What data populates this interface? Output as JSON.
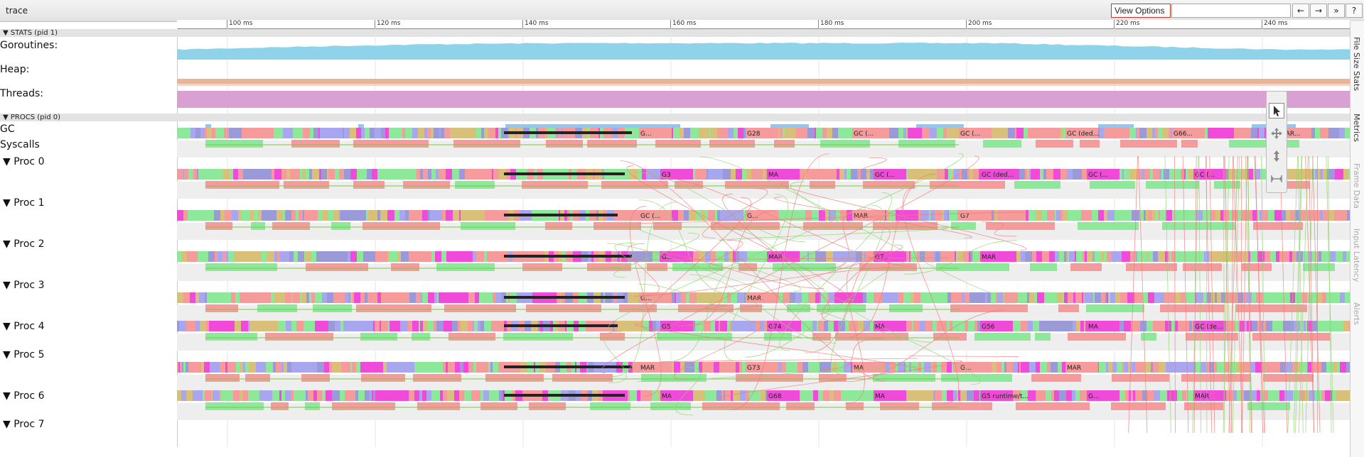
{
  "window": {
    "title": "trace"
  },
  "toolbar": {
    "view_options_label": "View Options",
    "search_placeholder": "",
    "prev_label": "←",
    "next_label": "→",
    "more_label": "»",
    "help_label": "?"
  },
  "ruler": {
    "ticks": [
      "100 ms",
      "120 ms",
      "140 ms",
      "160 ms",
      "180 ms",
      "200 ms",
      "220 ms",
      "240 ms"
    ]
  },
  "stats": {
    "header": "▼ STATS (pid 1)",
    "tracks": [
      {
        "label": "Goroutines:",
        "color": "#8fd3ea"
      },
      {
        "label": "Heap:",
        "color": "#e8b49a"
      },
      {
        "label": "Threads:",
        "color": "#d9a0d4"
      }
    ]
  },
  "procs": {
    "header": "▼ PROCS (pid 0)",
    "gc_label": "GC",
    "syscalls_label": "Syscalls",
    "gc_slice_label": "GC",
    "items": [
      {
        "label": "▼  Proc 0",
        "slices": [
          "G...",
          "G28",
          "GC (...",
          "GC (...",
          "GC (ded...",
          "G66...",
          "MAR...",
          "GC (..."
        ]
      },
      {
        "label": "▼  Proc 1",
        "slices": [
          "G3",
          "MA",
          "GC (...",
          "GC (ded...",
          "GC (...",
          "GC (..."
        ]
      },
      {
        "label": "▼  Proc 2",
        "slices": [
          "GC (...",
          "G...",
          "MAR",
          "G7"
        ]
      },
      {
        "label": "▼  Proc 3",
        "slices": [
          "G...",
          "MAR",
          "G7..",
          "MAR"
        ]
      },
      {
        "label": "▼  Proc 4",
        "slices": [
          "G...",
          "MAR"
        ]
      },
      {
        "label": "▼  Proc 5",
        "slices": [
          "G5",
          "G74",
          "MA",
          "G56",
          "MA",
          "GC (de..."
        ]
      },
      {
        "label": "▼  Proc 6",
        "slices": [
          "MAR",
          "G73",
          "MA",
          "G...",
          "MAR"
        ]
      },
      {
        "label": "▼  Proc 7",
        "slices": [
          "MA",
          "G68",
          "MA",
          "G5 runtime/t...",
          "G...",
          "MAR"
        ]
      }
    ]
  },
  "side_tabs": [
    "File Size Stats",
    "Metrics",
    "Frame Data",
    "Input Latency",
    "Alerts"
  ],
  "tools": [
    "select-icon",
    "pan-icon",
    "zoom-icon",
    "timing-icon"
  ],
  "colors": {
    "goroutines": "#8fd3ea",
    "heap": "#e8b49a",
    "threads": "#d9a0d4",
    "gc": "#8ec8f5",
    "salmon": "#f59b9b",
    "green": "#8de89a",
    "magenta": "#f04bd8",
    "lavender": "#a9a6f0",
    "olive": "#d9c07a",
    "flow_red": "#f07a7a",
    "flow_green": "#8fd46a"
  }
}
